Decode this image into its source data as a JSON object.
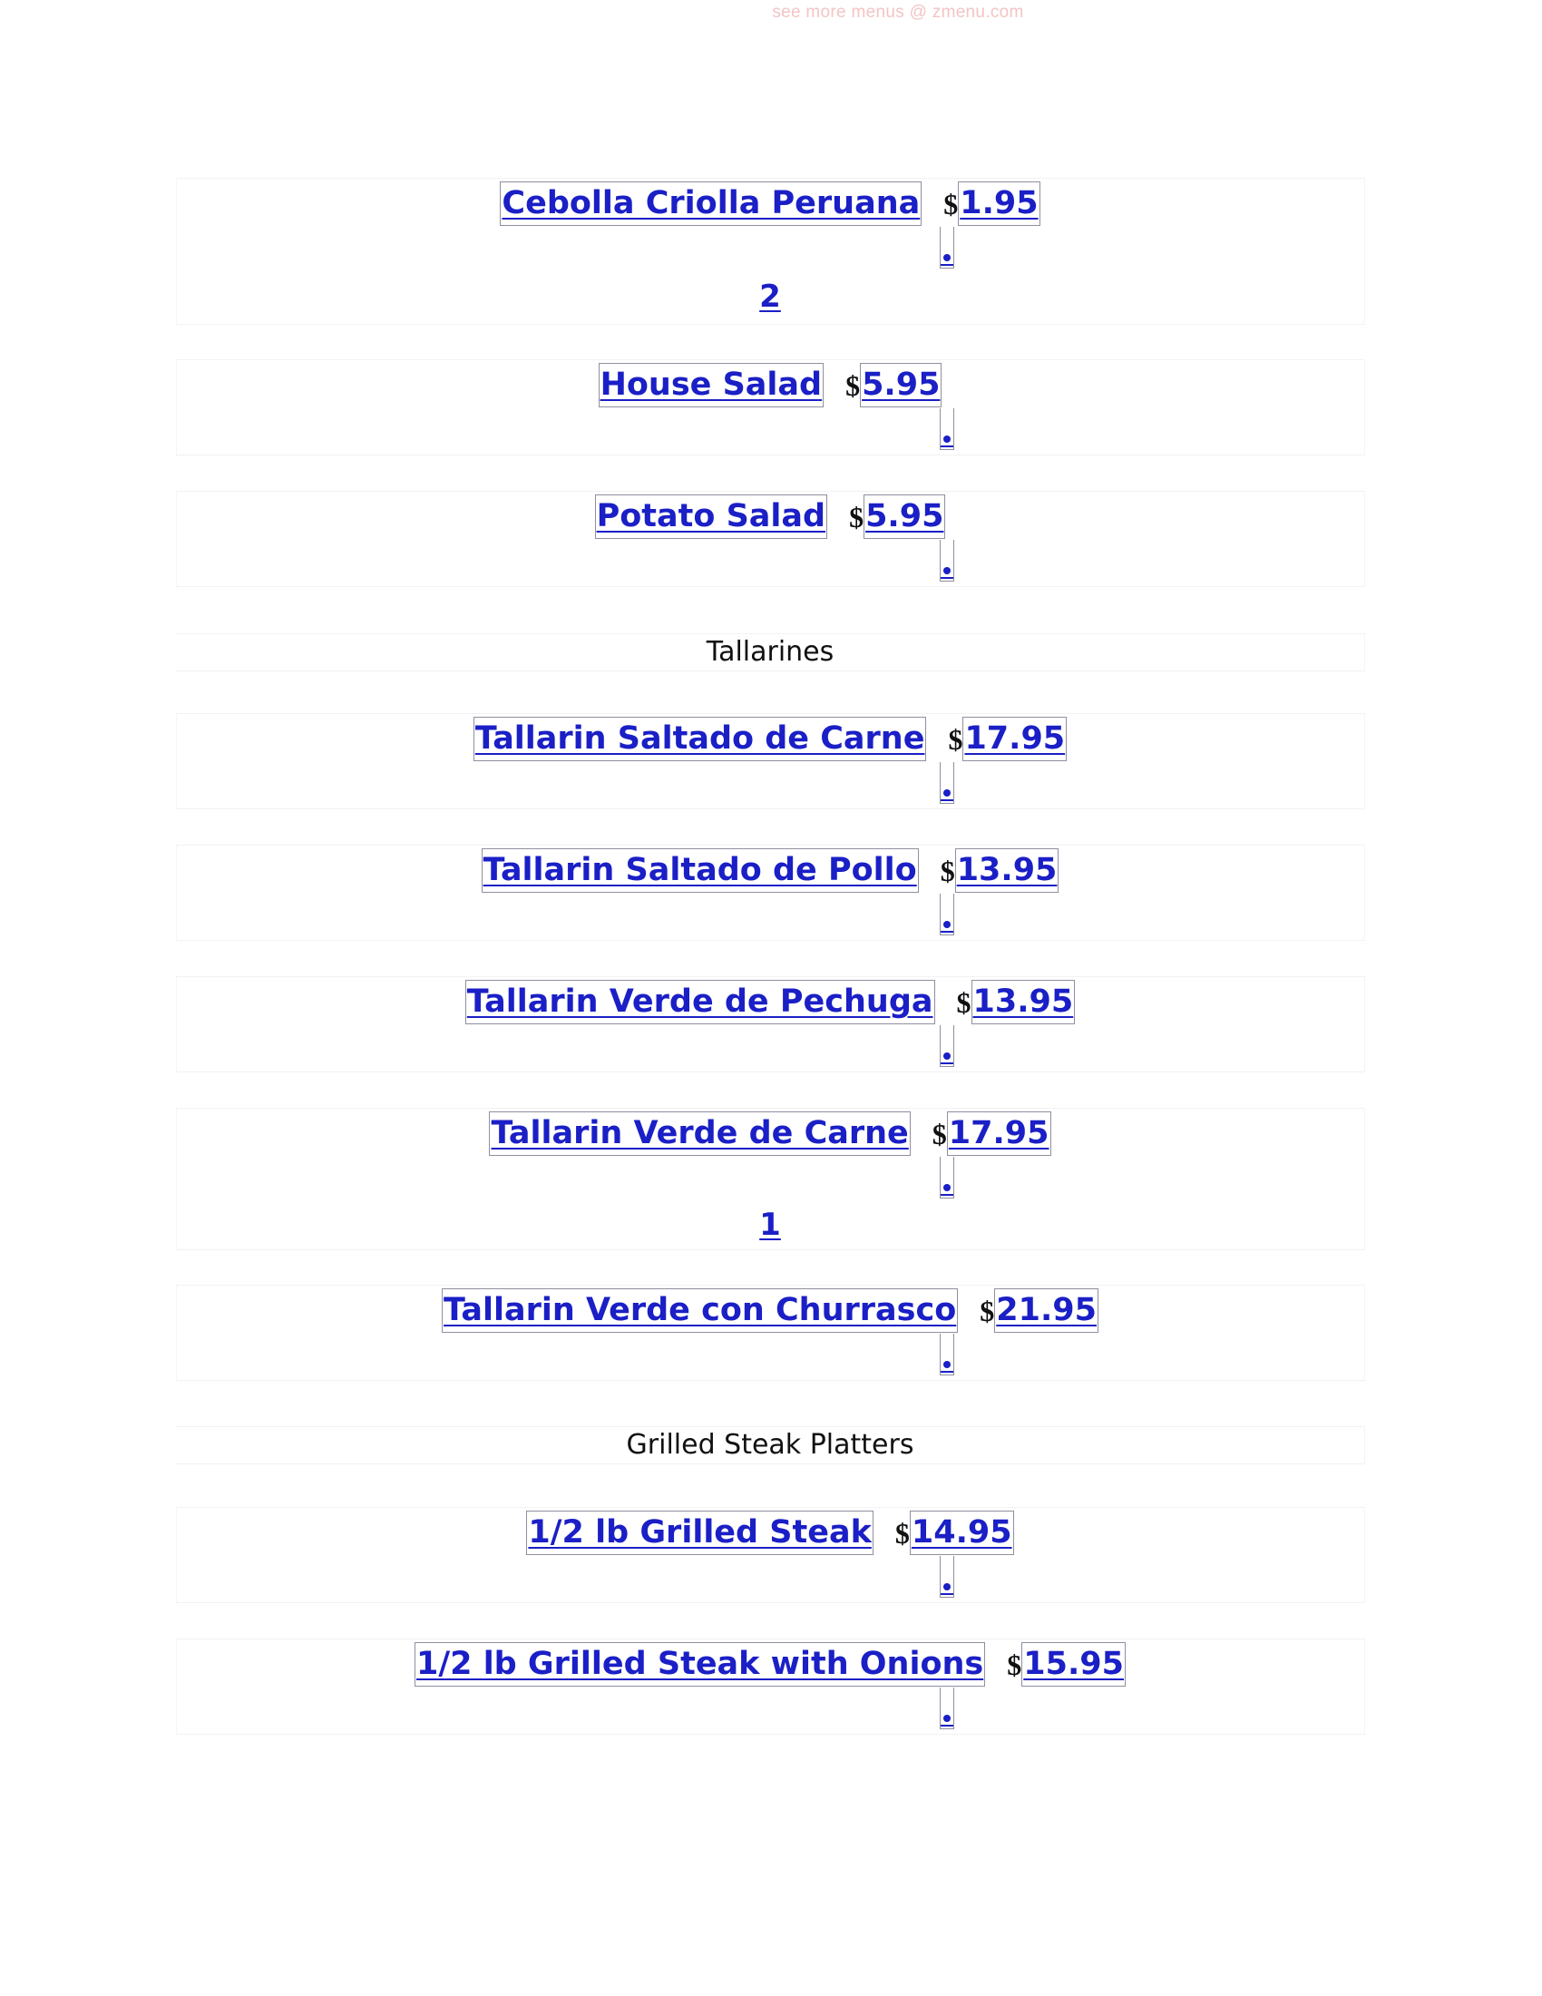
{
  "watermark": "see more menus @ zmenu.com",
  "sections": [
    {
      "heading": "",
      "items": [
        {
          "name": "Cebolla Criolla Peruana",
          "currency": "$",
          "price": "1.95",
          "count": "2"
        },
        {
          "name": "House Salad",
          "currency": "$",
          "price": "5.95",
          "count": ""
        },
        {
          "name": "Potato Salad",
          "currency": "$",
          "price": "5.95",
          "count": ""
        }
      ]
    },
    {
      "heading": "Tallarines",
      "items": [
        {
          "name": "Tallarin Saltado de Carne",
          "currency": "$",
          "price": "17.95",
          "count": ""
        },
        {
          "name": "Tallarin Saltado de Pollo",
          "currency": "$",
          "price": "13.95",
          "count": ""
        },
        {
          "name": "Tallarin Verde de Pechuga",
          "currency": "$",
          "price": "13.95",
          "count": ""
        },
        {
          "name": "Tallarin Verde de Carne",
          "currency": "$",
          "price": "17.95",
          "count": "1"
        },
        {
          "name": "Tallarin Verde con Churrasco",
          "currency": "$",
          "price": "21.95",
          "count": ""
        }
      ]
    },
    {
      "heading": "Grilled Steak Platters",
      "items": [
        {
          "name": "1/2 lb Grilled Steak",
          "currency": "$",
          "price": "14.95",
          "count": ""
        },
        {
          "name": "1/2 lb Grilled Steak with Onions",
          "currency": "$",
          "price": "15.95",
          "count": ""
        }
      ]
    }
  ]
}
